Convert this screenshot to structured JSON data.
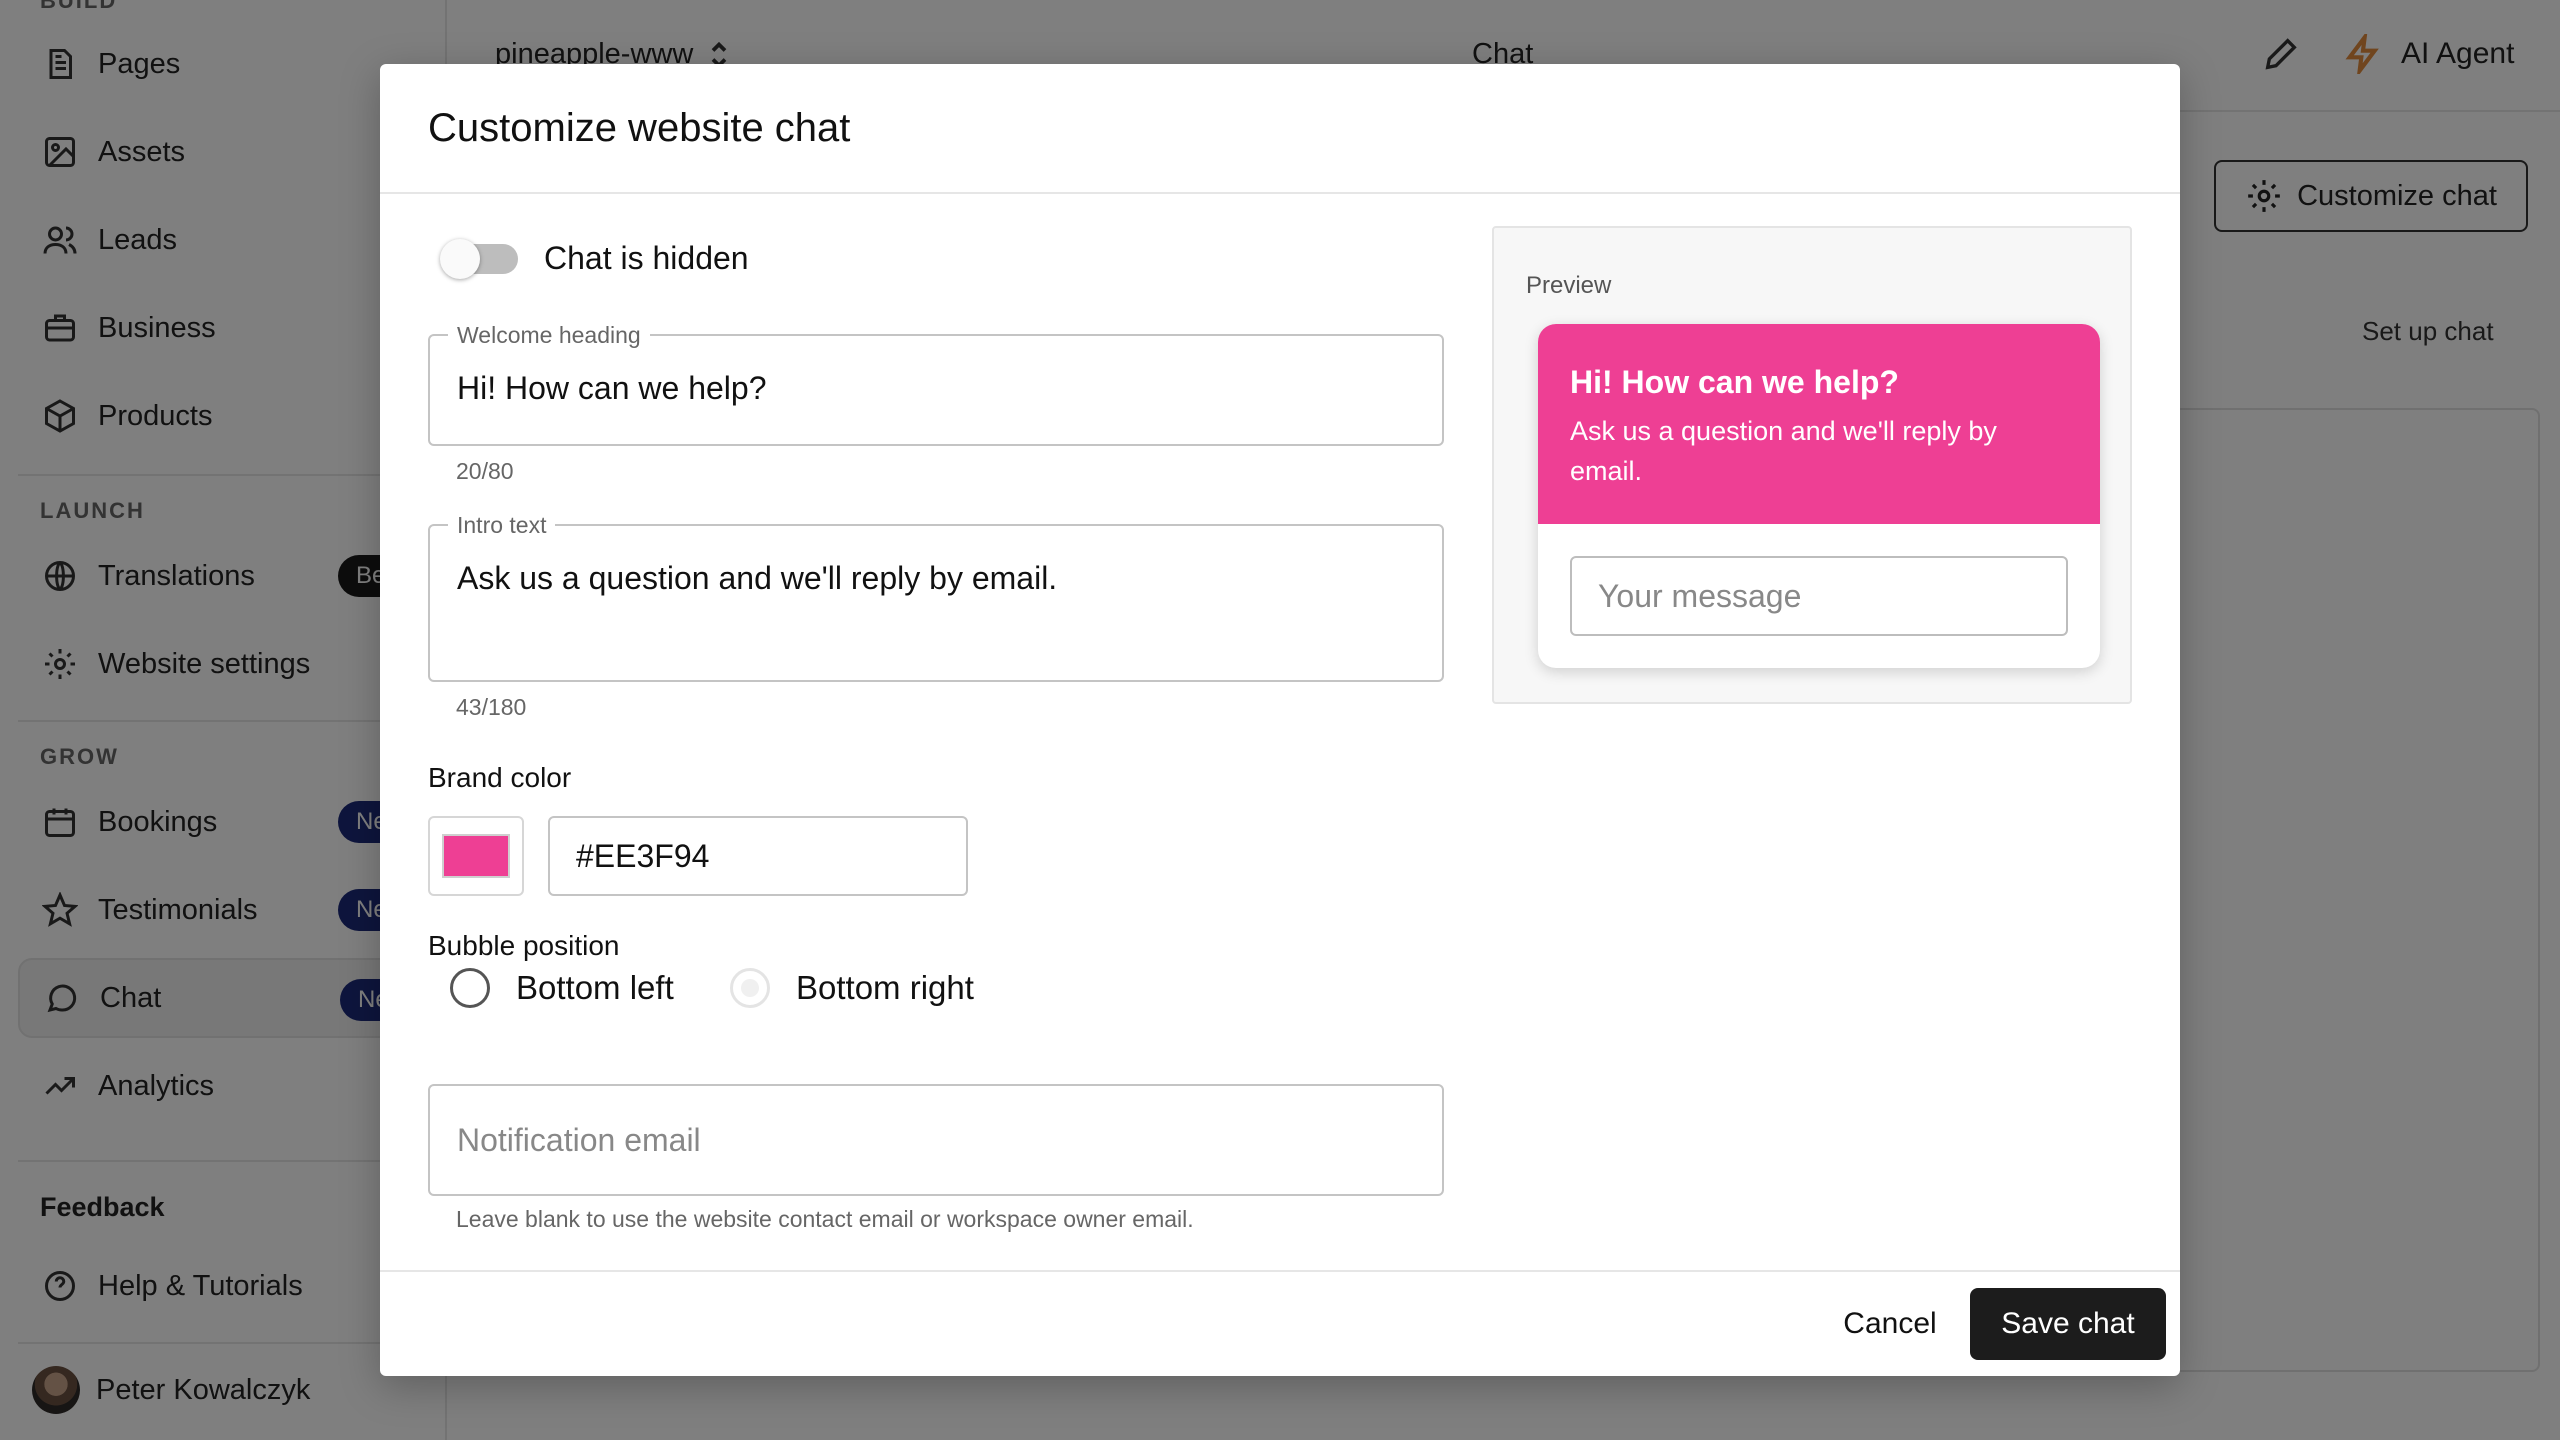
{
  "sidebar": {
    "build_label": "BUILD",
    "launch_label": "LAUNCH",
    "grow_label": "GROW",
    "items": [
      {
        "label": "Pages",
        "icon": "page-icon"
      },
      {
        "label": "Assets",
        "icon": "image-icon"
      },
      {
        "label": "Leads",
        "icon": "users-icon"
      },
      {
        "label": "Business",
        "icon": "briefcase-icon"
      },
      {
        "label": "Products",
        "icon": "box-icon"
      },
      {
        "label": "Translations",
        "icon": "globe-icon",
        "badge": "Beta"
      },
      {
        "label": "Website settings",
        "icon": "gear-icon"
      },
      {
        "label": "Bookings",
        "icon": "calendar-icon",
        "badge": "New"
      },
      {
        "label": "Testimonials",
        "icon": "star-icon",
        "badge": "New"
      },
      {
        "label": "Chat",
        "icon": "chat-bubble-icon",
        "badge": "New",
        "active": true
      },
      {
        "label": "Analytics",
        "icon": "trend-icon"
      }
    ],
    "feedback": "Feedback",
    "help": "Help & Tutorials",
    "user_name": "Peter Kowalczyk"
  },
  "topbar": {
    "site_name": "pineapple-www",
    "page_title": "Chat",
    "ai_agent": "AI Agent"
  },
  "background": {
    "customize_button": "Customize chat",
    "setup_chat": "Set up chat"
  },
  "modal": {
    "title": "Customize website chat",
    "toggle_label": "Chat is hidden",
    "toggle_on": false,
    "welcome_heading": {
      "label": "Welcome heading",
      "value": "Hi! How can we help?",
      "counter": "20/80"
    },
    "intro_text": {
      "label": "Intro text",
      "value": "Ask us a question and we'll reply by email.",
      "counter": "43/180"
    },
    "brand_color_label": "Brand color",
    "brand_color": "#EE3F94",
    "bubble_position_label": "Bubble position",
    "positions": [
      "Bottom left",
      "Bottom right"
    ],
    "notification_email": {
      "placeholder": "Notification email",
      "helper": "Leave blank to use the website contact email or workspace owner email."
    },
    "preview": {
      "label": "Preview",
      "heading": "Hi! How can we help?",
      "intro": "Ask us a question and we'll reply by email.",
      "input_placeholder": "Your message"
    },
    "cancel": "Cancel",
    "save": "Save chat"
  }
}
